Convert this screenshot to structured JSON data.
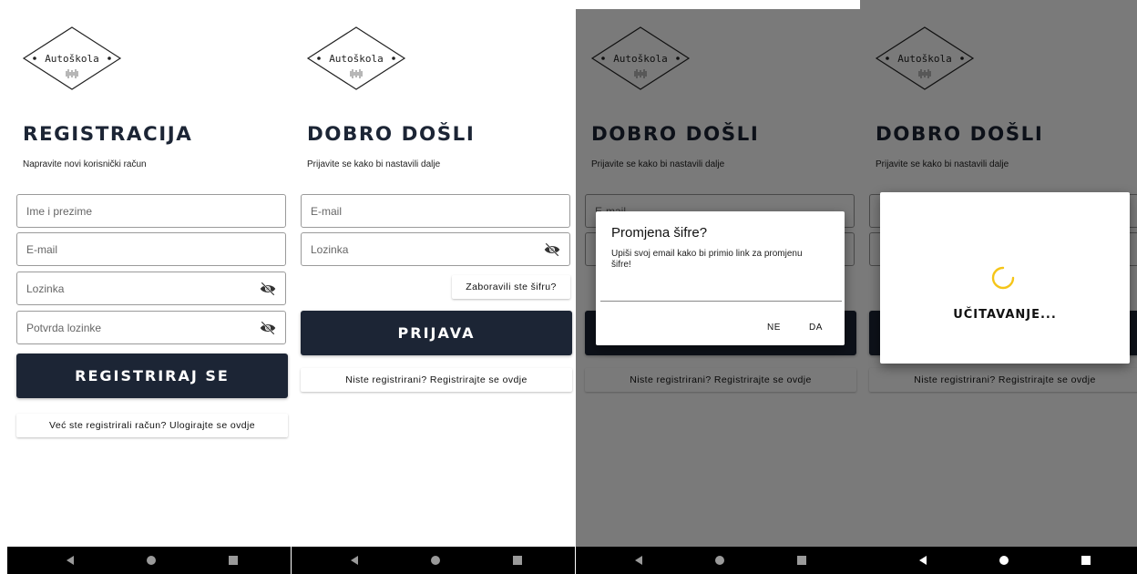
{
  "brand": {
    "logo_text": "Autoškola"
  },
  "register_screen": {
    "title": "REGISTRACIJA",
    "subtitle": "Napravite novi korisnički račun",
    "name_placeholder": "Ime i prezime",
    "email_placeholder": "E-mail",
    "password_placeholder": "Lozinka",
    "confirm_placeholder": "Potvrda lozinke",
    "submit_label": "REGISTRIRAJ SE",
    "login_link": "Već ste registrirali račun? Ulogirajte se ovdje"
  },
  "login_screen": {
    "title": "DOBRO DOŠLI",
    "subtitle": "Prijavite se kako bi nastavili dalje",
    "email_placeholder": "E-mail",
    "password_placeholder": "Lozinka",
    "forgot_label": "Zaboravili ste šifru?",
    "submit_label": "PRIJAVA",
    "register_link": "Niste registrirani? Registrirajte se ovdje"
  },
  "reset_dialog": {
    "title": "Promjena šifre?",
    "message": "Upiši svoj email kako bi primio link za promjenu šifre!",
    "no_label": "NE",
    "yes_label": "DA"
  },
  "loading_dialog": {
    "text": "UČITAVANJE..."
  },
  "colors": {
    "primary_dark": "#1c2535",
    "spinner": "#f5c518",
    "scrim": "rgba(0,0,0,0.52)"
  },
  "icons": [
    "logo-diamond-icon",
    "eye-off-icon",
    "back-icon",
    "home-icon",
    "recents-icon",
    "spinner-icon"
  ]
}
